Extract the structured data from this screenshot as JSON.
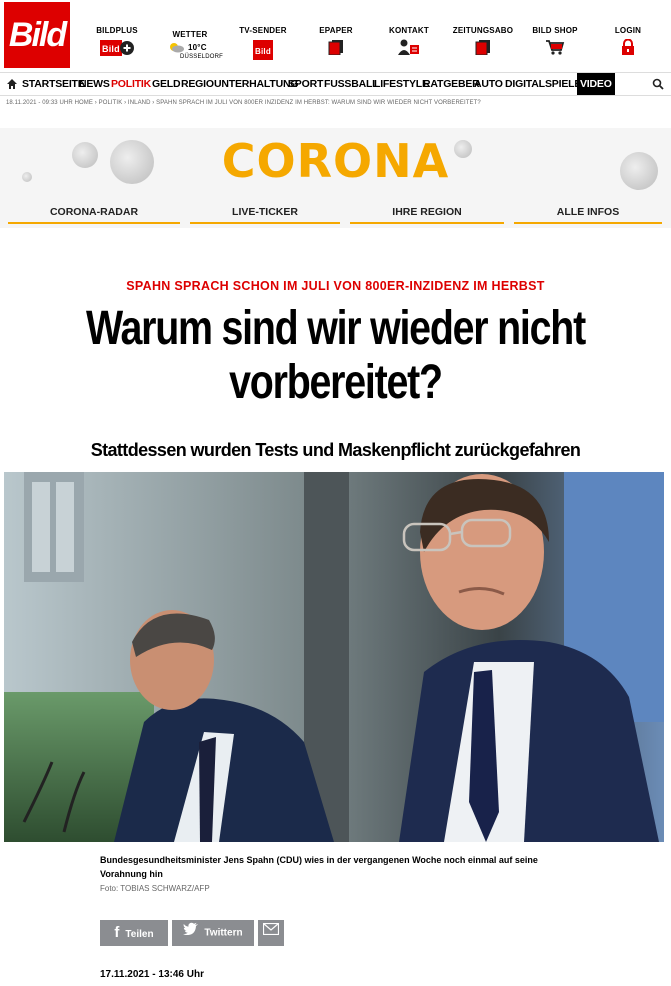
{
  "logo": "Bild",
  "tools": [
    {
      "label": "BILDPLUS",
      "sub": "",
      "icon": "bildplus-icon"
    },
    {
      "label": "WETTER",
      "sub": "10°C",
      "sub2": "DÜSSELDORF",
      "icon": "weather-icon"
    },
    {
      "label": "TV-SENDER",
      "sub": "",
      "icon": "tv-icon"
    },
    {
      "label": "EPAPER",
      "sub": "",
      "icon": "epaper-icon"
    },
    {
      "label": "KONTAKT",
      "sub": "",
      "icon": "contact-icon"
    },
    {
      "label": "ZEITUNGSABO",
      "sub": "",
      "icon": "newspaper-icon"
    },
    {
      "label": "BILD SHOP",
      "sub": "",
      "icon": "cart-icon"
    },
    {
      "label": "LOGIN",
      "sub": "",
      "icon": "lock-icon"
    }
  ],
  "nav": {
    "items": [
      "STARTSEITE",
      "NEWS",
      "POLITIK",
      "GELD",
      "REGIO",
      "UNTERHALTUNG",
      "SPORT",
      "FUSSBALL",
      "LIFESTYLE",
      "RATGEBER",
      "AUTO",
      "DIGITAL",
      "SPIELE",
      "VIDEO"
    ],
    "active": "POLITIK",
    "active_color": "#dd0000"
  },
  "breadcrumb": "18.11.2021 - 09:33 UHR   HOME › POLITIK › INLAND › SPAHN SPRACH IM JULI VON 800ER INZIDENZ IM HERBST: WARUM SIND WIR WIEDER NICHT VORBEREITET?",
  "corona": {
    "title": "CORONA",
    "buttons": [
      "CORONA-RADAR",
      "LIVE-TICKER",
      "IHRE REGION",
      "ALLE INFOS"
    ],
    "accent": "#f5a800"
  },
  "article": {
    "kicker": "SPAHN SPRACH SCHON IM JULI VON 800ER-INZIDENZ IM HERBST",
    "headline_line1": "Warum sind wir wieder nicht",
    "headline_line2": "vorbereitet?",
    "subhead": "Stattdessen wurden Tests und Maskenpflicht zurückgefahren",
    "caption": "Bundesgesundheitsminister Jens Spahn (CDU) wies in der vergangenen Woche noch einmal auf seine Vorahnung hin",
    "credit": "Foto: TOBIAS SCHWARZ/AFP",
    "date": "17.11.2021 - 13:46 Uhr"
  },
  "share": {
    "facebook": "Teilen",
    "twitter": "Twittern"
  }
}
